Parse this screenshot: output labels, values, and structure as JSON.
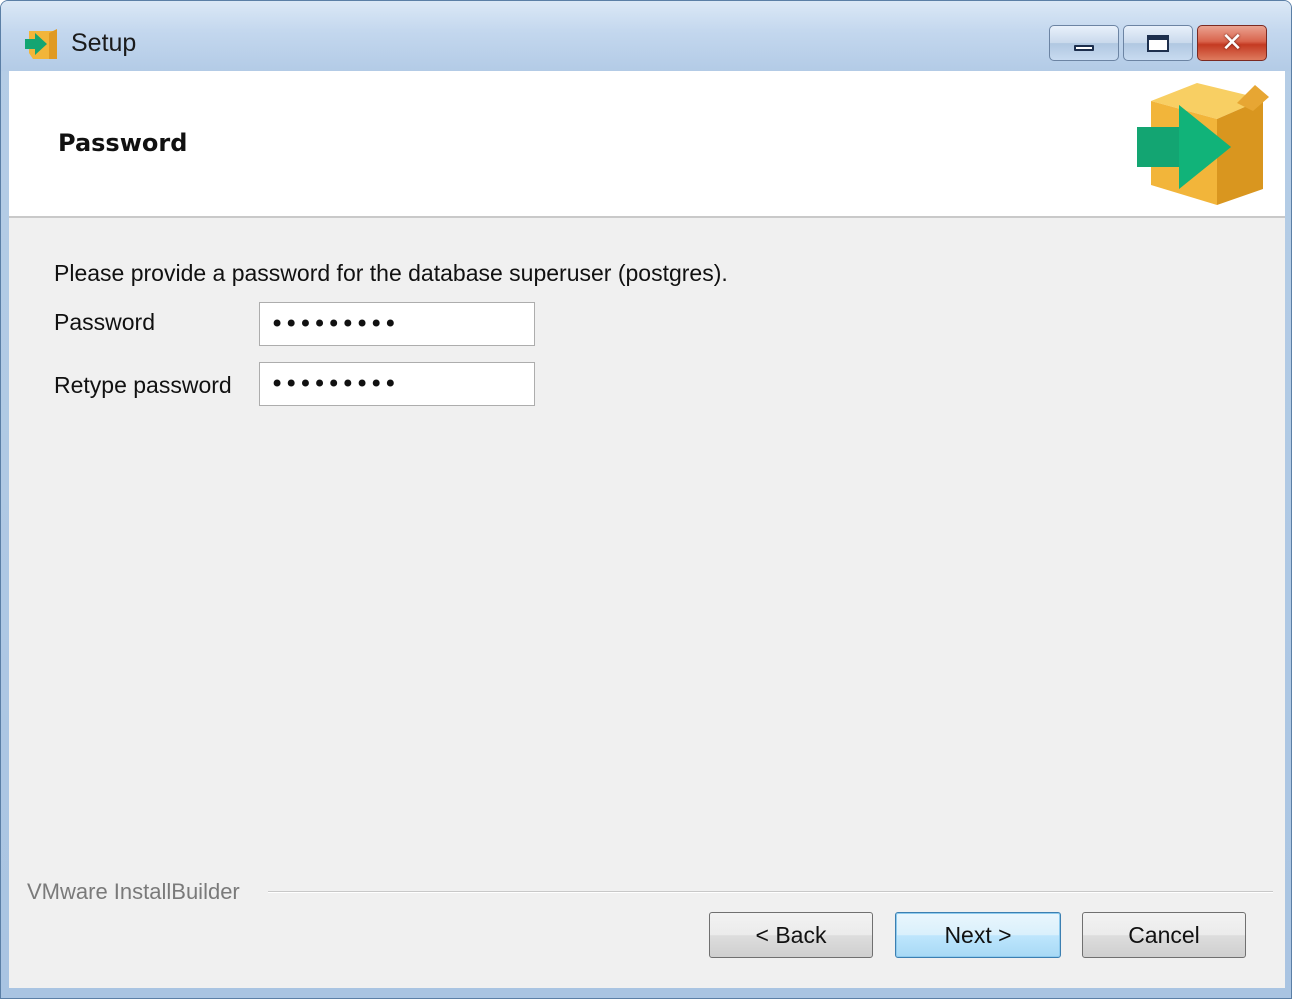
{
  "window": {
    "title": "Setup",
    "icon": "installer-box-icon"
  },
  "header": {
    "title": "Password",
    "icon": "installer-box-icon"
  },
  "form": {
    "instructions": "Please provide a password for the database superuser (postgres).",
    "password_label": "Password",
    "password_value": "•••••••••",
    "retype_label": "Retype password",
    "retype_value": "•••••••••"
  },
  "footer": {
    "brand": "VMware InstallBuilder",
    "back_label": "< Back",
    "next_label": "Next >",
    "cancel_label": "Cancel"
  },
  "colors": {
    "box_orange": "#f2b53a",
    "arrow_green": "#13a572",
    "close_red": "#c9442b",
    "default_button_blue": "#bee6fd"
  }
}
